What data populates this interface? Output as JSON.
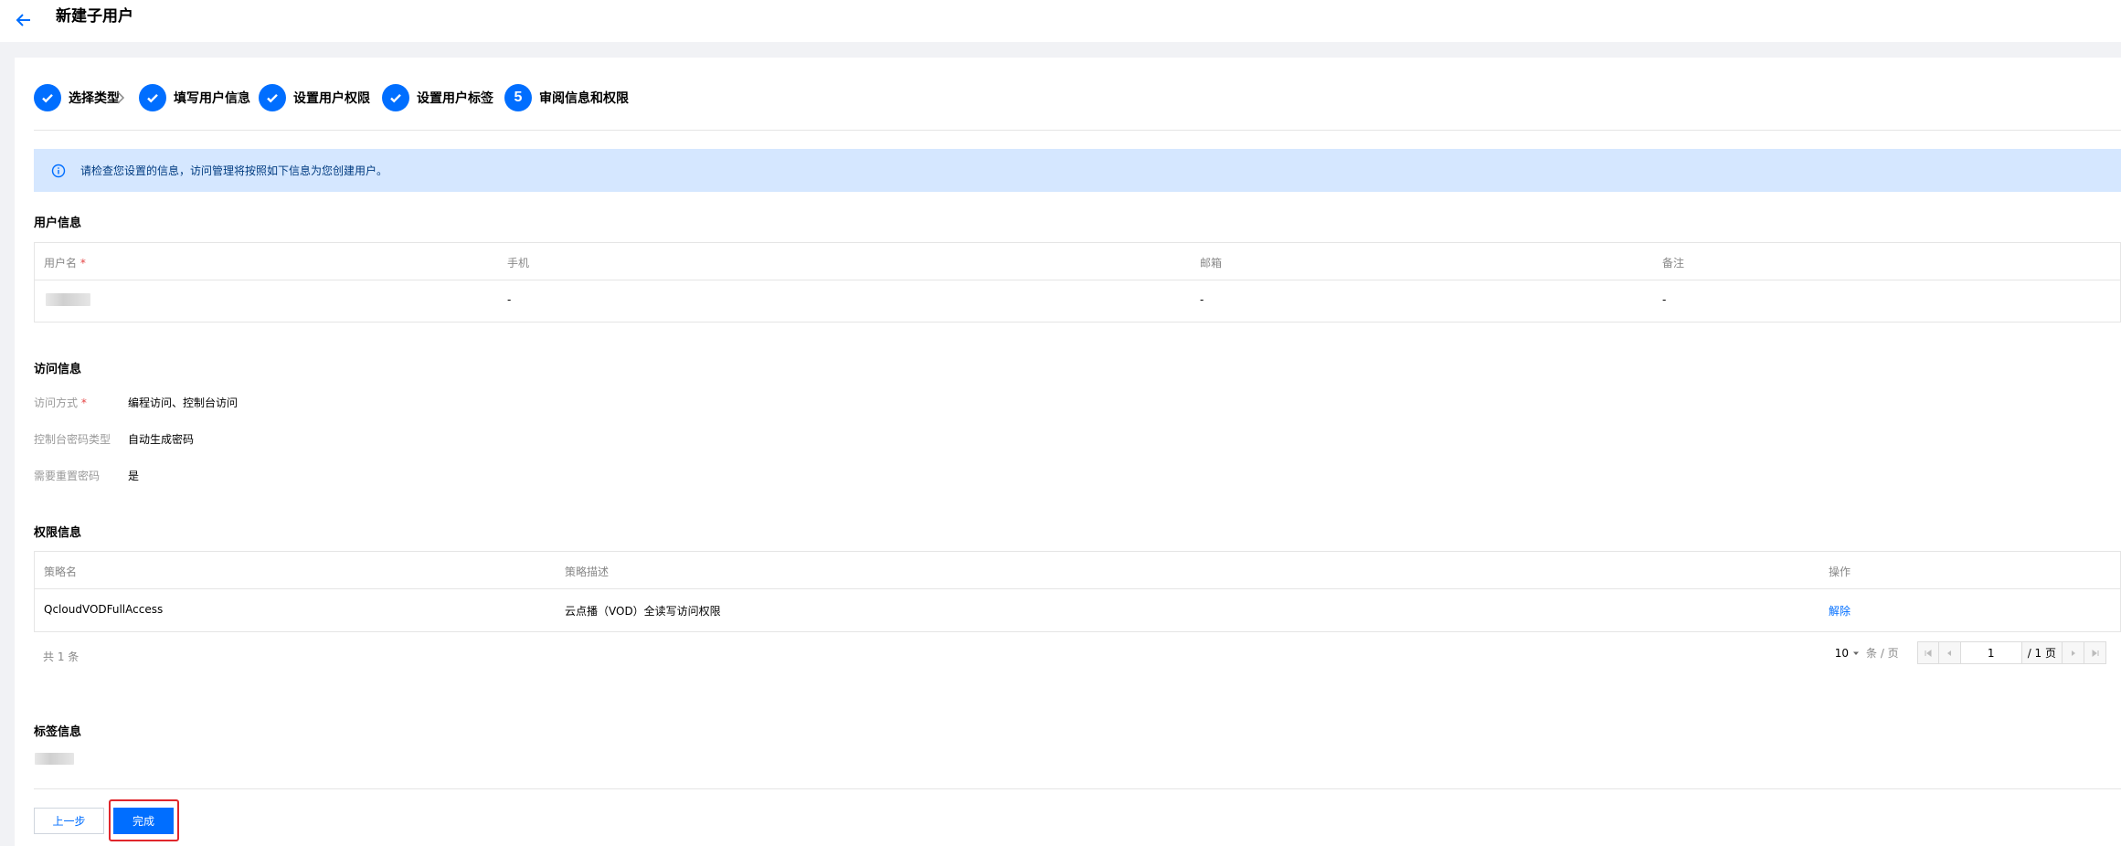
{
  "header": {
    "title": "新建子用户"
  },
  "steps": [
    {
      "label": "选择类型",
      "done": true
    },
    {
      "label": "填写用户信息",
      "done": true
    },
    {
      "label": "设置用户权限",
      "done": true
    },
    {
      "label": "设置用户标签",
      "done": true
    },
    {
      "label": "审阅信息和权限",
      "number": "5",
      "done": false
    }
  ],
  "alert": {
    "text": "请检查您设置的信息，访问管理将按照如下信息为您创建用户。"
  },
  "user_info": {
    "title": "用户信息",
    "columns": [
      "用户名",
      "手机",
      "邮箱",
      "备注"
    ],
    "required_mark": "*",
    "row": {
      "phone": "-",
      "email": "-",
      "remark": "-"
    }
  },
  "access_info": {
    "title": "访问信息",
    "rows": [
      {
        "label": "访问方式",
        "required": "*",
        "value": "编程访问、控制台访问"
      },
      {
        "label": "控制台密码类型",
        "value": "自动生成密码"
      },
      {
        "label": "需要重置密码",
        "value": "是"
      }
    ]
  },
  "permission_info": {
    "title": "权限信息",
    "columns": [
      "策略名",
      "策略描述",
      "操作"
    ],
    "rows": [
      {
        "name": "QcloudVODFullAccess",
        "desc": "云点播（VOD）全读写访问权限",
        "action": "解除"
      }
    ],
    "total": "共 1 条",
    "page_size": "10",
    "page_unit": "条 / 页",
    "current_page": "1",
    "pages": "/ 1 页"
  },
  "tag_info": {
    "title": "标签信息"
  },
  "footer": {
    "prev_label": "上一步",
    "done_label": "完成"
  },
  "colors": {
    "primary": "#006eff",
    "alert_bg": "#d5e7ff",
    "highlight": "#e0262b"
  }
}
